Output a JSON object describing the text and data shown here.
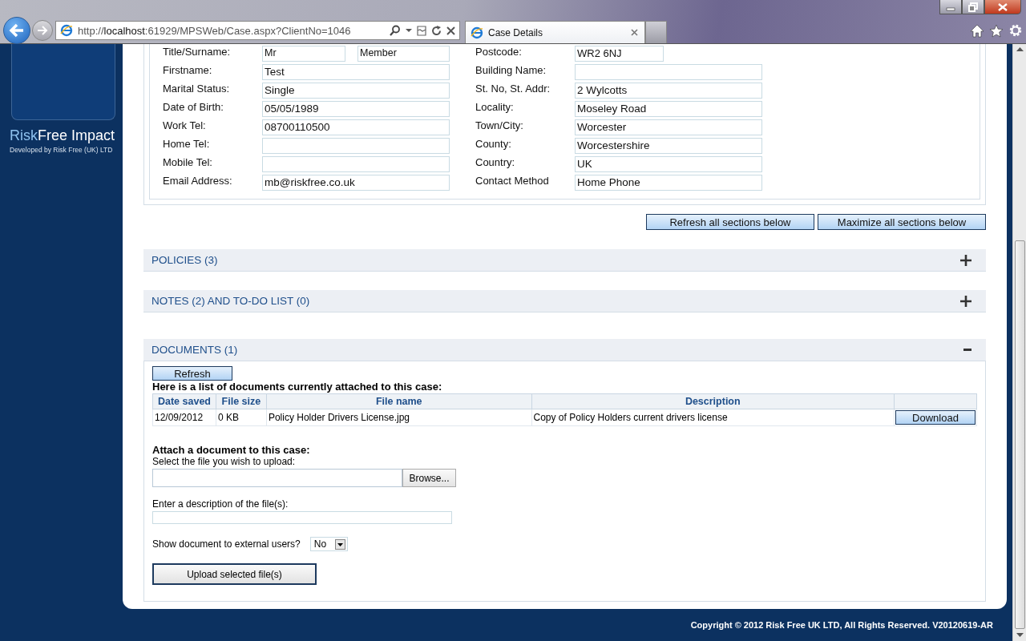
{
  "browser": {
    "url": "http://**localhost**:61929/MPSWeb/Case.aspx?ClientNo=1046",
    "tab": "Case Details"
  },
  "sidebar": {
    "brand_highlight": "Risk",
    "brand_rest": "Free Impact",
    "tagline": "Developed by Risk Free (UK) LTD"
  },
  "personal_left": [
    {
      "kind": "pair",
      "label": "Title/Surname:",
      "values": [
        "Mr",
        "Member"
      ]
    },
    {
      "kind": "text",
      "label": "Firstname:",
      "value": "Test"
    },
    {
      "kind": "text",
      "label": "Marital Status:",
      "value": "Single"
    },
    {
      "kind": "text",
      "label": "Date of Birth:",
      "value": "05/05/1989"
    },
    {
      "kind": "text",
      "label": "Work Tel:",
      "value": "08700110500"
    },
    {
      "kind": "text",
      "label": "Home Tel:"
    },
    {
      "kind": "text",
      "label": "Mobile Tel:"
    },
    {
      "kind": "text",
      "label": "Email Address:",
      "value": "mb@riskfree.co.uk"
    }
  ],
  "personal_right": [
    {
      "kind": "short",
      "label": "Postcode:",
      "value": "WR2 6NJ"
    },
    {
      "kind": "text",
      "label": "Building Name:"
    },
    {
      "kind": "text",
      "label": "St. No, St. Addr:",
      "value": "2 Wylcotts"
    },
    {
      "kind": "text",
      "label": "Locality:",
      "value": "Moseley Road"
    },
    {
      "kind": "text",
      "label": "Town/City:",
      "value": "Worcester"
    },
    {
      "kind": "text",
      "label": "County:",
      "value": "Worcestershire"
    },
    {
      "kind": "text",
      "label": "Country:",
      "value": "UK"
    },
    {
      "kind": "text",
      "label": "Contact Method",
      "value": "Home Phone"
    }
  ],
  "section_buttons": [
    "Refresh all sections below",
    "Maximize all sections below"
  ],
  "sections": [
    {
      "title": "POLICIES (3)",
      "expanded": false
    },
    {
      "title": "NOTES (2) AND TO-DO LIST (0)",
      "expanded": false
    },
    {
      "title": "DOCUMENTS (1)",
      "expanded": true
    }
  ],
  "documents": {
    "refresh_button": "Refresh",
    "intro": "Here is a list of documents currently attached to this case:",
    "columns": [
      "Date saved",
      "File size",
      "File name",
      "Description"
    ],
    "rows": [
      {
        "date": "12/09/2012",
        "size": "0 KB",
        "name": "Policy Holder Drivers License.jpg",
        "description": "Copy of Policy Holders current drivers license",
        "action": "Download"
      }
    ],
    "attach_heading": "Attach a document to this case:",
    "file_label": "Select the file you wish to upload:",
    "browse_button": "Browse...",
    "description_label": "Enter a description of the file(s):",
    "external_label": "Show document to external users?",
    "external_value": "No",
    "upload_button": "Upload selected file(s)"
  },
  "footer": "Copyright © 2012 Risk Free UK LTD, All Rights Reserved. V20120619-AR"
}
